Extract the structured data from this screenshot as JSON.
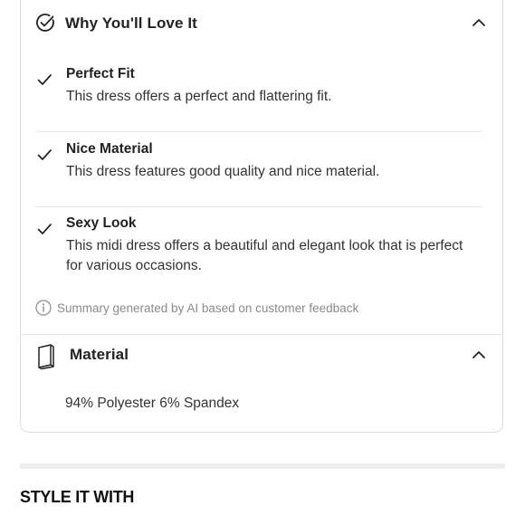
{
  "love_section": {
    "title": "Why You'll Love It",
    "features": [
      {
        "title": "Perfect Fit",
        "description": "This dress offers a perfect and flattering fit."
      },
      {
        "title": "Nice Material",
        "description": "This dress features good quality and nice material."
      },
      {
        "title": "Sexy Look",
        "description": "This midi dress offers a beautiful and elegant look that is perfect for various occasions."
      }
    ],
    "ai_note": "Summary generated by AI based on customer feedback"
  },
  "material_section": {
    "title": "Material",
    "value": "94% Polyester 6% Spandex"
  },
  "style_it_with": {
    "title": "STYLE IT WITH"
  },
  "colors": {
    "text": "#222222",
    "muted": "#8a8a8a",
    "border": "#dcdcdc",
    "band": "#eeeeee"
  },
  "icons": {
    "love_header": "check-circle-icon",
    "feature": "check-icon",
    "collapse": "chevron-up-icon",
    "material_header": "fabric-icon",
    "ai_note": "info-icon"
  }
}
